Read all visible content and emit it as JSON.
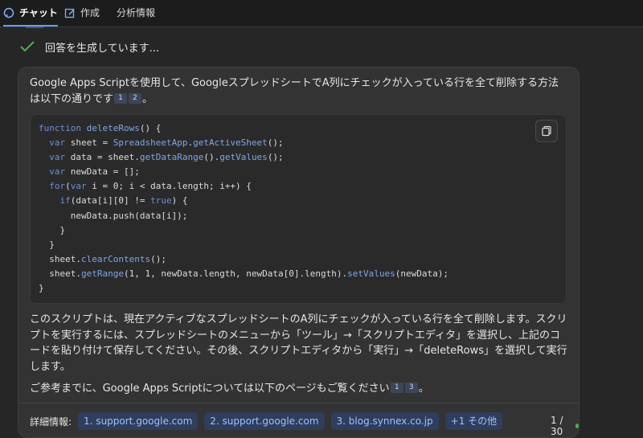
{
  "tabs": [
    {
      "label": "チャット",
      "icon": "chat-bubble-icon"
    },
    {
      "label": "作成",
      "icon": "edit-icon"
    },
    {
      "label": "分析情報",
      "icon": ""
    }
  ],
  "status": {
    "text": "回答を生成しています..."
  },
  "answer": {
    "intro_text": "Google Apps Scriptを使用して、GoogleスプレッドシートでA列にチェックが入っている行を全て削除する方法は以下の通りです",
    "intro_cites": [
      "1",
      "2"
    ],
    "intro_end": "。",
    "code": {
      "lines": [
        "function deleteRows() {",
        "  var sheet = SpreadsheetApp.getActiveSheet();",
        "  var data = sheet.getDataRange().getValues();",
        "  var newData = [];",
        "  for(var i = 0; i < data.length; i++) {",
        "    if(data[i][0] != true) {",
        "      newData.push(data[i]);",
        "    }",
        "  }",
        "  sheet.clearContents();",
        "  sheet.getRange(1, 1, newData.length, newData[0].length).setValues(newData);",
        "}"
      ]
    },
    "explanation": "このスクリプトは、現在アクティブなスプレッドシートのA列にチェックが入っている行を全て削除します。スクリプトを実行するには、スプレッドシートのメニューから「ツール」→「スクリプトエディタ」を選択し、上記のコードを貼り付けて保存してください。その後、スクリプトエディタから「実行」→「deleteRows」を選択して実行します。",
    "ref_text": "ご参考までに、Google Apps Scriptについては以下のページもご覧ください",
    "ref_cites": [
      "1",
      "3"
    ],
    "ref_end": "。"
  },
  "references": {
    "label": "詳細情報:",
    "chips": [
      "1. support.google.com",
      "2. support.google.com",
      "3. blog.synnex.co.jp",
      "+1 その他"
    ]
  },
  "counter": "1 / 30"
}
